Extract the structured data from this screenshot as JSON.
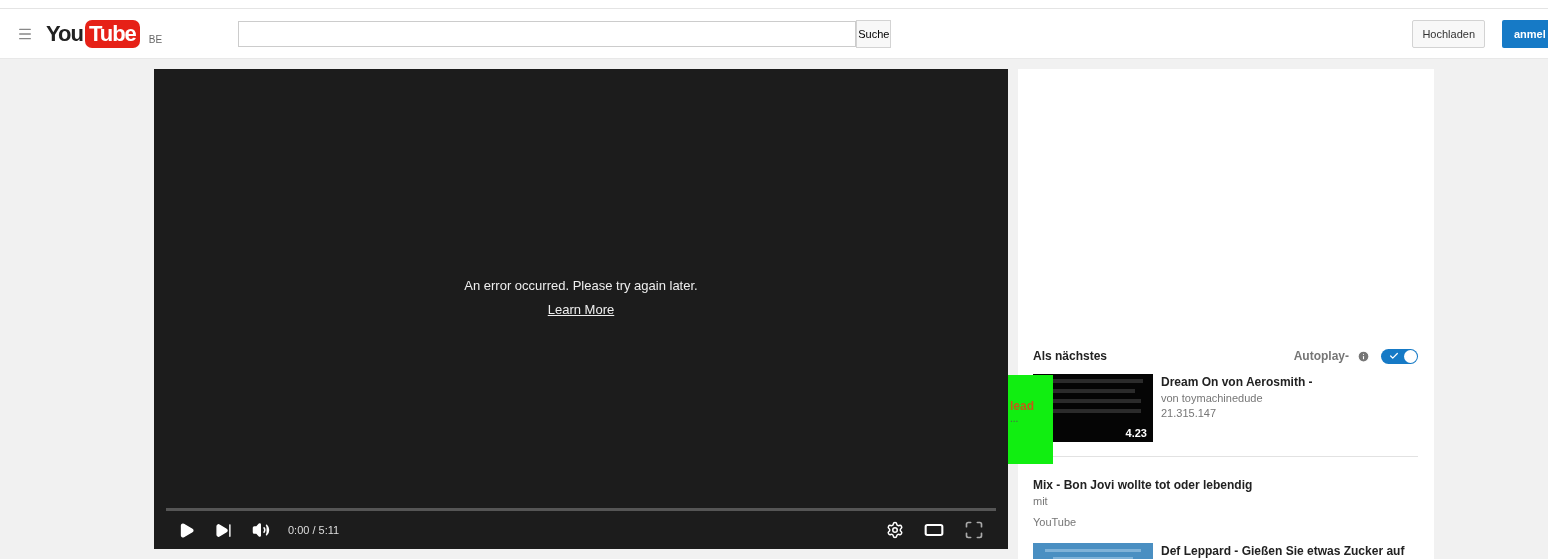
{
  "header": {
    "logo": {
      "you": "You",
      "tube": "Tube"
    },
    "region": "BE",
    "search_button": "Suche",
    "upload_button": "Hochladen",
    "signin_button": "anmel"
  },
  "player": {
    "error": "An error occurred. Please try again later.",
    "link": "Learn More",
    "time": "0:00 / 5:11",
    "progress": {
      "level": 0
    }
  },
  "sidebar": {
    "heading": "Als nächstes",
    "autoplay": {
      "label": "Autoplay-",
      "on": true
    },
    "items": [
      {
        "kind": "video",
        "title": "Dream On von Aerosmith -",
        "channel": "von toymachinedude",
        "views": "21.315.147",
        "duration": "4.23"
      },
      {
        "kind": "mix",
        "title": "Mix - Bon Jovi wollte tot oder lebendig",
        "channel": "mit",
        "views": "YouTube"
      },
      {
        "kind": "video",
        "title": "Def Leppard - Gießen Sie etwas Zucker auf"
      }
    ]
  },
  "overlay": {
    "text": "lead",
    "ellipsis": "..."
  }
}
